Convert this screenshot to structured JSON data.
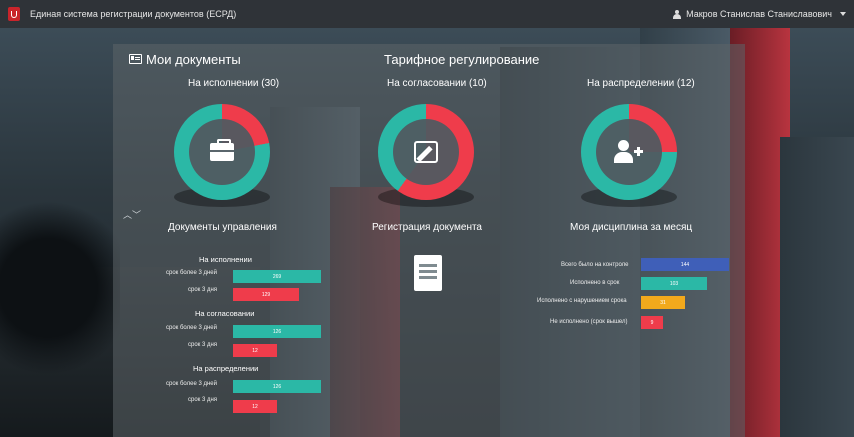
{
  "navbar": {
    "title": "Единая система регистрации документов (ЕСРД)",
    "user": "Макров Станислав Станиславович"
  },
  "headings": {
    "my_documents": "Мои документы",
    "tariff": "Тарифное регулирование"
  },
  "donuts": [
    {
      "label": "На исполнении (30)",
      "icon": "briefcase-icon",
      "teal_pct": 78,
      "red_pct": 22
    },
    {
      "label": "На согласовании (10)",
      "icon": "edit-icon",
      "teal_pct": 40,
      "red_pct": 60
    },
    {
      "label": "На распределении  (12)",
      "icon": "user-add-icon",
      "teal_pct": 75,
      "red_pct": 25
    }
  ],
  "sections": {
    "management": "Документы управления",
    "registration": "Регистрация документа",
    "discipline": "Моя дисциплина за месяц"
  },
  "management": {
    "groups": [
      {
        "title": "На исполнении",
        "rows": [
          {
            "label": "срок более 3 дней",
            "value": "269"
          },
          {
            "label": "срок 3 дня",
            "value": "129"
          }
        ]
      },
      {
        "title": "На согласовании",
        "rows": [
          {
            "label": "срок более 3 дней",
            "value": "126"
          },
          {
            "label": "срок 3 дня",
            "value": "12"
          }
        ]
      },
      {
        "title": "На распределении",
        "rows": [
          {
            "label": "срок более 3 дней",
            "value": "126"
          },
          {
            "label": "срок 3 дня",
            "value": "12"
          }
        ]
      }
    ]
  },
  "discipline": {
    "rows": [
      {
        "label": "Всего было на контроле",
        "value": "144",
        "color": "#3f5fb8"
      },
      {
        "label": "Исполнено в срок",
        "value": "103",
        "color": "#2bb8a6"
      },
      {
        "label": "Исполнено с нарушением срока",
        "value": "31",
        "color": "#f2a91c"
      },
      {
        "label": "Не исполнено (срок вышел)",
        "value": "9",
        "color": "#ef3c4b"
      }
    ]
  },
  "colors": {
    "teal": "#2bb8a6",
    "red": "#ef3c4b",
    "navbar": "#2f3338"
  }
}
